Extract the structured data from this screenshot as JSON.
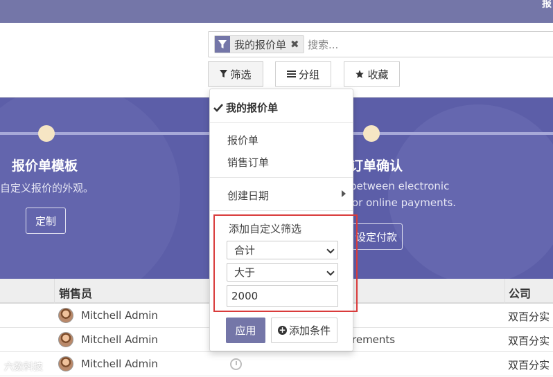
{
  "topbar": {
    "corner_text": "报"
  },
  "search": {
    "facet_label": "我的报价单",
    "facet_remove": "✖",
    "placeholder": "搜索..."
  },
  "control_buttons": {
    "filter_label": "筛选",
    "group_label": "分组",
    "favorites_label": "收藏"
  },
  "banner": {
    "left": {
      "title": "报价单模板",
      "text": "自定义报价的外观。",
      "button": "定制"
    },
    "right": {
      "title": "订单确认",
      "text_line1": "between electronic",
      "text_line2": "or online payments.",
      "button": "设定付款"
    }
  },
  "filter_dropdown": {
    "checked_item": "我的报价单",
    "items": [
      "报价单",
      "销售订单"
    ],
    "date_item": "创建日期",
    "custom_filter": {
      "title": "添加自定义筛选",
      "field": "合计",
      "operator": "大于",
      "value": "2000"
    },
    "apply_label": "应用",
    "add_condition_label": "添加条件"
  },
  "table": {
    "headers": {
      "salesperson": "销售员",
      "company": "公司"
    },
    "rows": [
      {
        "salesperson": "Mitchell Admin",
        "mid": "",
        "company": "双百分实"
      },
      {
        "salesperson": "Mitchell Admin",
        "mid": "rements",
        "company": "双百分实"
      },
      {
        "salesperson": "Mitchell Admin",
        "mid": "",
        "company": "双百分实"
      }
    ]
  },
  "watermark": "六数科技",
  "colors": {
    "primary": "#7476a8",
    "highlight_border": "#d93b3b"
  }
}
